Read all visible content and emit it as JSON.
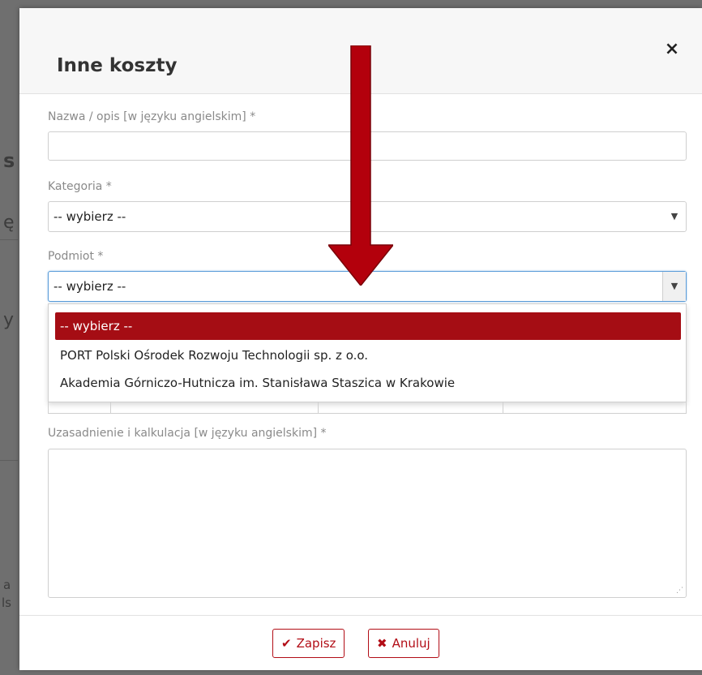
{
  "backdrop": {
    "fragments": [
      "s",
      "ę",
      "y",
      "a",
      "ls"
    ]
  },
  "modal": {
    "title": "Inne koszty",
    "close_symbol": "×",
    "fields": {
      "name_label": "Nazwa / opis [w języku angielskim] *",
      "name_value": "",
      "category_label": "Kategoria *",
      "category_value": "-- wybierz --",
      "entity_label": "Podmiot *",
      "entity_value": "-- wybierz --",
      "justification_label": "Uzasadnienie i kalkulacja [w języku angielskim] *",
      "justification_value": ""
    },
    "dropdown": {
      "options": [
        "-- wybierz --",
        "PORT Polski Ośrodek Rozwoju Technologii sp. z o.o.",
        "Akademia Górniczo-Hutnicza im. Stanisława Staszica w Krakowie"
      ],
      "selected_index": 0
    },
    "footer": {
      "save_label": "Zapisz",
      "cancel_label": "Anuluj"
    }
  },
  "colors": {
    "accent": "#a50d14",
    "button_border": "#b20d16",
    "focus": "#5b9dd9",
    "arrow": "#b3000c"
  },
  "icons": {
    "close": "close-icon",
    "save": "check-icon",
    "cancel": "x-icon",
    "select": "chevron-down-icon"
  }
}
